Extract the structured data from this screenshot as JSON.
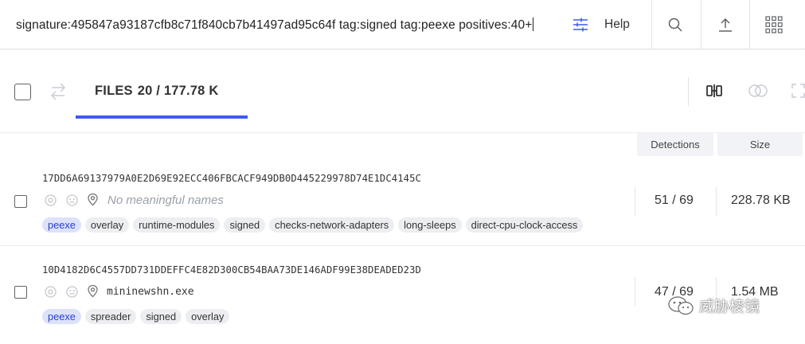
{
  "search": {
    "query": "signature:495847a93187cfb8c71f840cb7b41497ad95c64f tag:signed tag:peexe positives:40+"
  },
  "header": {
    "help_label": "Help",
    "icons": [
      "filter-settings-icon",
      "search-icon",
      "upload-icon",
      "apps-grid-icon"
    ]
  },
  "toolbar": {
    "tab_label": "FILES",
    "tab_count": "20 / 177.78 K",
    "accent_color": "#3f5aef",
    "icons": [
      "swap-icon",
      "compare-icon",
      "overlap-icon",
      "expand-icon"
    ]
  },
  "columns": {
    "detections": "Detections",
    "size": "Size"
  },
  "rows": [
    {
      "hash": "17DD6A69137979A0E2D69E92ECC406FBCACF949DB0D445229978D74E1DC4145C",
      "name": "No meaningful names",
      "name_is_placeholder": true,
      "tags": [
        "peexe",
        "overlay",
        "runtime-modules",
        "signed",
        "checks-network-adapters",
        "long-sleeps",
        "direct-cpu-clock-access"
      ],
      "detections": "51 / 69",
      "size": "228.78 KB"
    },
    {
      "hash": "10D4182D6C4557DD731DDEFFC4E82D300CB54BAA73DE146ADF99E38DEADED23D",
      "name": "mininewshn.exe",
      "name_is_placeholder": false,
      "tags": [
        "peexe",
        "spreader",
        "signed",
        "overlay"
      ],
      "detections": "47 / 69",
      "size": "1.54 MB"
    }
  ],
  "watermark": {
    "text": "威胁棱镜"
  }
}
